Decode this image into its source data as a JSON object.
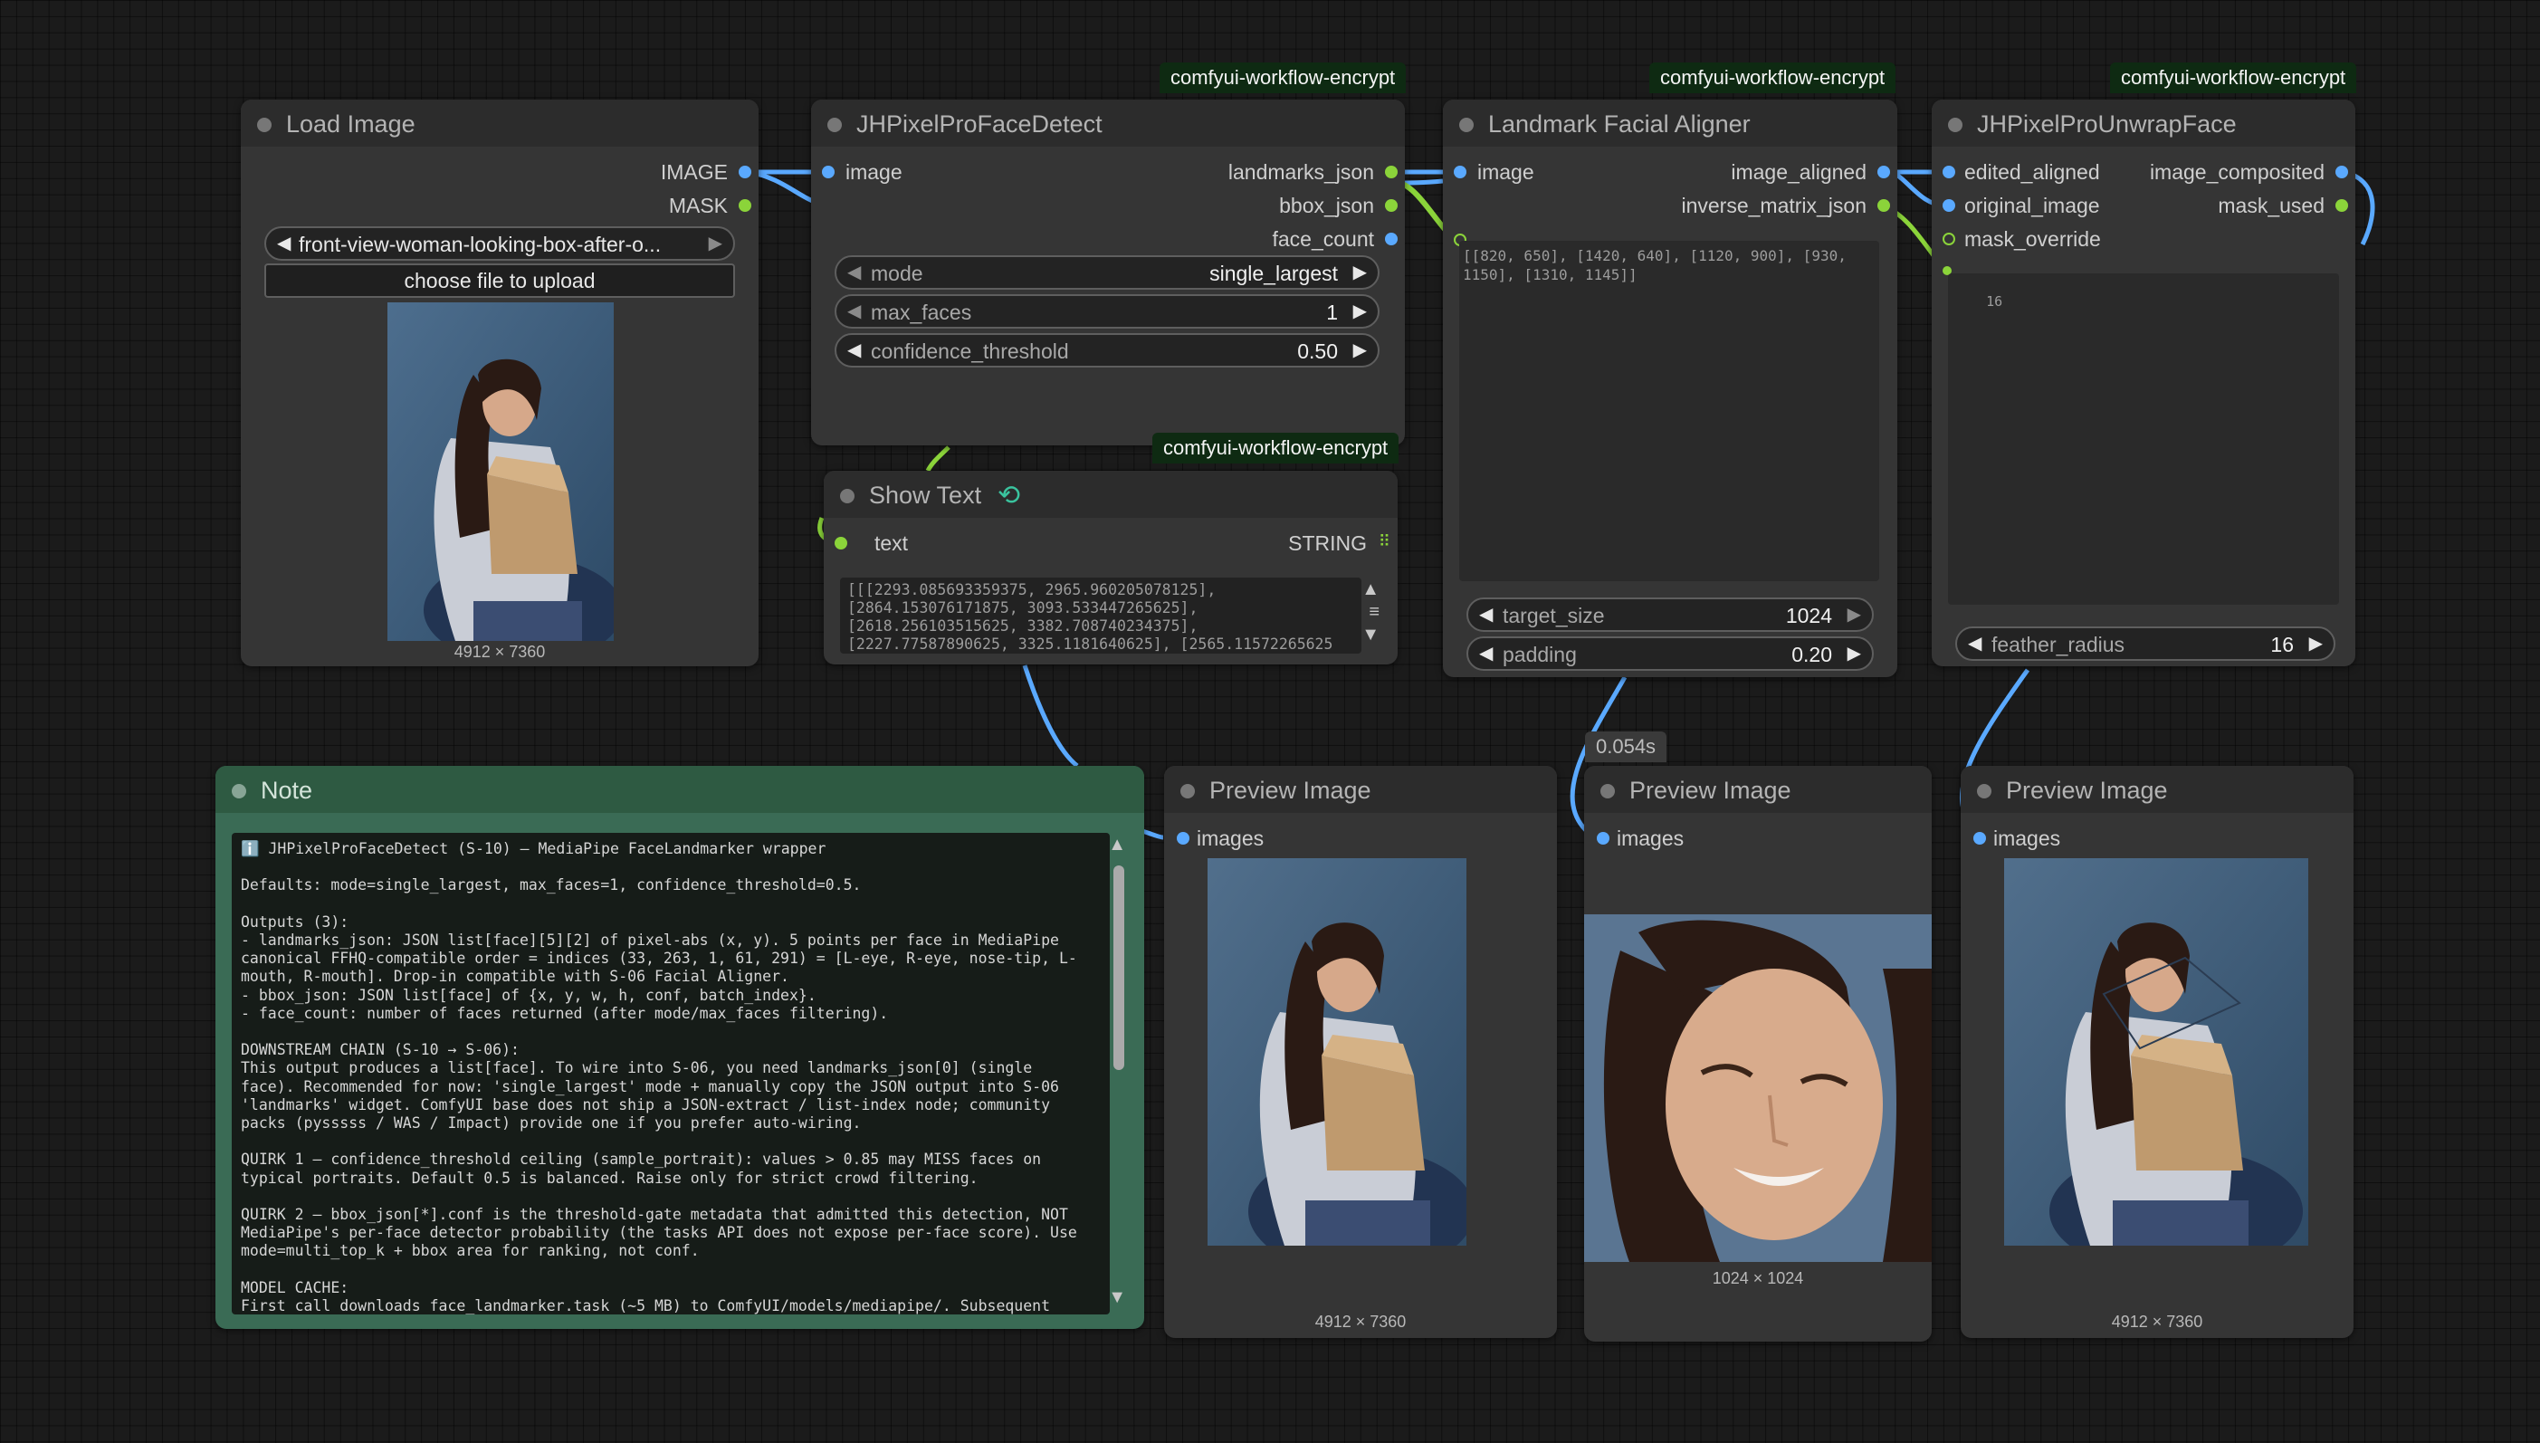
{
  "badges": {
    "face_detect": "comfyui-workflow-encrypt",
    "aligner": "comfyui-workflow-encrypt",
    "unwrap": "comfyui-workflow-encrypt",
    "show_text": "comfyui-workflow-encrypt"
  },
  "load_image": {
    "title": "Load Image",
    "outputs": [
      "IMAGE",
      "MASK"
    ],
    "file": "front-view-woman-looking-box-after-o...",
    "upload_label": "choose file to upload",
    "dimensions": "4912 × 7360"
  },
  "face_detect": {
    "title": "JHPixelProFaceDetect",
    "input": "image",
    "outputs": [
      "landmarks_json",
      "bbox_json",
      "face_count"
    ],
    "widgets": [
      {
        "label": "mode",
        "value": "single_largest"
      },
      {
        "label": "max_faces",
        "value": "1"
      },
      {
        "label": "confidence_threshold",
        "value": "0.50"
      }
    ]
  },
  "show_text": {
    "title": "Show Text",
    "icon": "refresh-icon",
    "input": "text",
    "output": "STRING",
    "content": "[[[2293.085693359375, 2965.960205078125],\n[2864.153076171875, 3093.533447265625],\n[2618.256103515625, 3382.708740234375],\n[2227.77587890625, 3325.1181640625], [2565.11572265625"
  },
  "aligner": {
    "title": "Landmark Facial Aligner",
    "input": "image",
    "outputs": [
      "image_aligned",
      "inverse_matrix_json"
    ],
    "matrix_text": "[[820, 650], [1420, 640], [1120, 900], [930,\n1150], [1310, 1145]]",
    "widgets": [
      {
        "label": "target_size",
        "value": "1024"
      },
      {
        "label": "padding",
        "value": "0.20"
      }
    ]
  },
  "unwrap": {
    "title": "JHPixelProUnwrapFace",
    "inputs": [
      "edited_aligned",
      "original_image",
      "mask_override"
    ],
    "outputs": [
      "image_composited",
      "mask_used"
    ],
    "preview_value": "16",
    "widgets": [
      {
        "label": "feather_radius",
        "value": "16"
      }
    ]
  },
  "note": {
    "title": "Note",
    "text": "ℹ️ JHPixelProFaceDetect (S-10) — MediaPipe FaceLandmarker wrapper\n\nDefaults: mode=single_largest, max_faces=1, confidence_threshold=0.5.\n\nOutputs (3):\n- landmarks_json: JSON list[face][5][2] of pixel-abs (x, y). 5 points per face in MediaPipe\ncanonical FFHQ-compatible order = indices (33, 263, 1, 61, 291) = [L-eye, R-eye, nose-tip, L-\nmouth, R-mouth]. Drop-in compatible with S-06 Facial Aligner.\n- bbox_json: JSON list[face] of {x, y, w, h, conf, batch_index}.\n- face_count: number of faces returned (after mode/max_faces filtering).\n\nDOWNSTREAM CHAIN (S-10 → S-06):\nThis output produces a list[face]. To wire into S-06, you need landmarks_json[0] (single\nface). Recommended for now: 'single_largest' mode + manually copy the JSON output into S-06\n'landmarks' widget. ComfyUI base does not ship a JSON-extract / list-index node; community\npacks (pysssss / WAS / Impact) provide one if you prefer auto-wiring.\n\nQUIRK 1 — confidence_threshold ceiling (sample_portrait): values > 0.85 may MISS faces on\ntypical portraits. Default 0.5 is balanced. Raise only for strict crowd filtering.\n\nQUIRK 2 — bbox_json[*].conf is the threshold-gate metadata that admitted this detection, NOT\nMediaPipe's per-face detector probability (the tasks API does not expose per-face score). Use\nmode=multi_top_k + bbox area for ranking, not conf.\n\nMODEL CACHE:\nFirst call downloads face_landmarker.task (~5 MB) to ComfyUI/models/mediapipe/. Subsequent"
  },
  "preview1": {
    "title": "Preview Image",
    "input": "images",
    "dimensions": "4912 × 7360"
  },
  "preview2": {
    "title": "Preview Image",
    "input": "images",
    "dimensions": "1024 × 1024",
    "timing": "0.054s"
  },
  "preview3": {
    "title": "Preview Image",
    "input": "images",
    "dimensions": "4912 × 7360"
  },
  "colors": {
    "image_wire": "#5aa9ff",
    "json_wire": "#8bd43a",
    "note_header": "#2e5a42",
    "badge_bg": "#0e2a12"
  }
}
